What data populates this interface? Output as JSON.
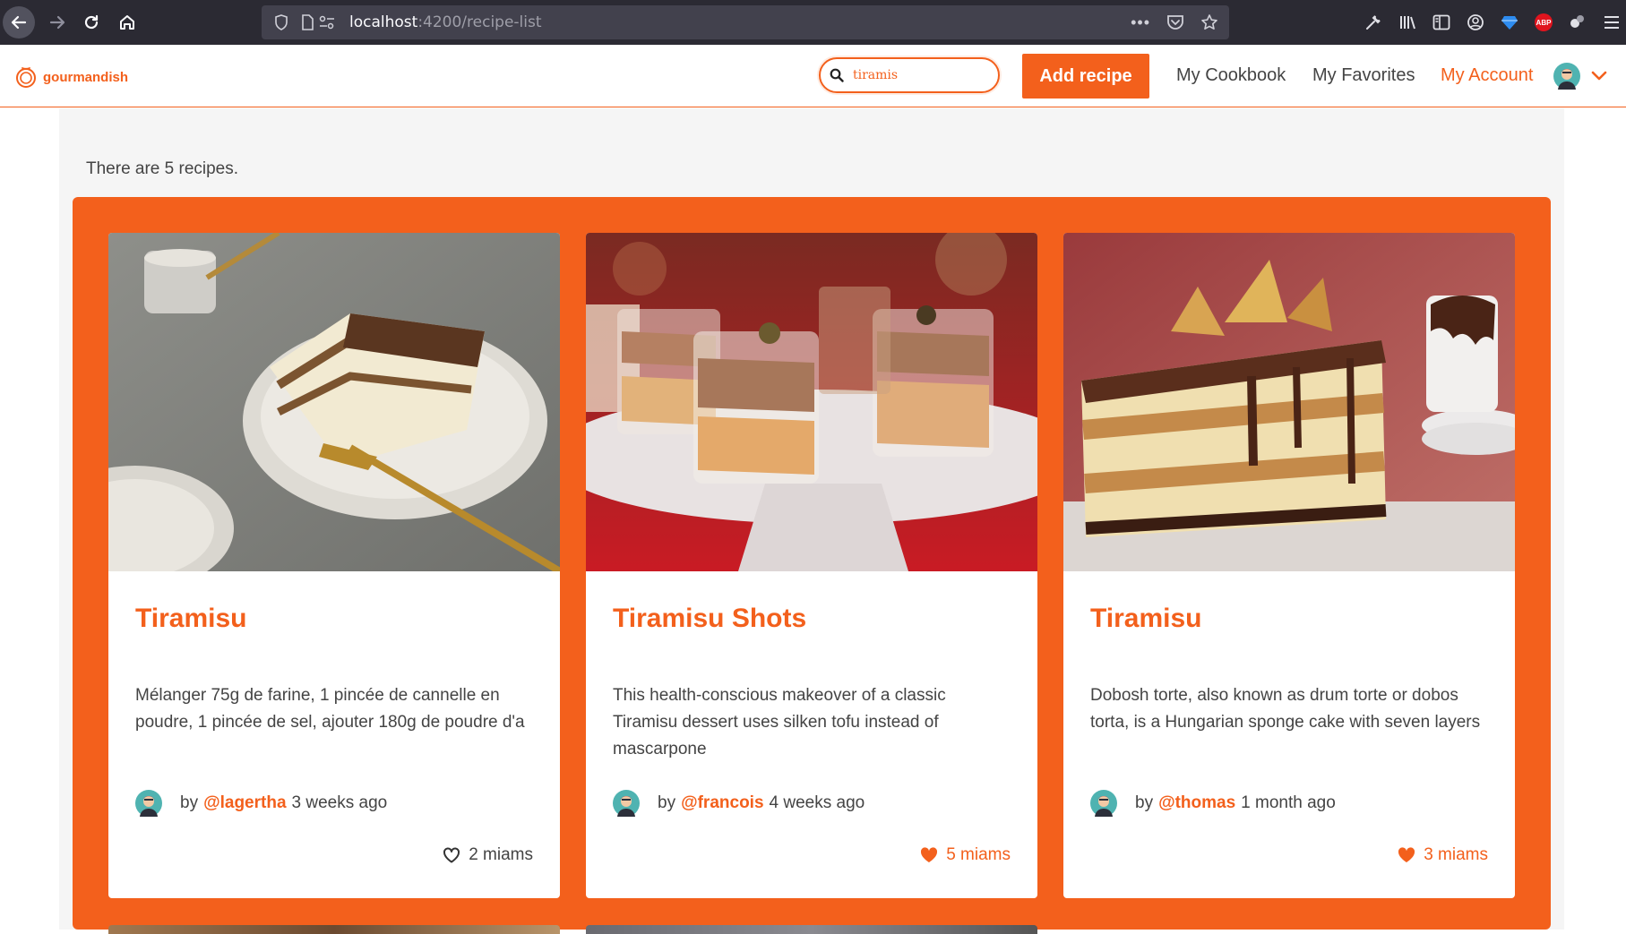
{
  "browser": {
    "url_host": "localhost",
    "url_path": ":4200/recipe-list"
  },
  "header": {
    "logo_text": "gourmandish",
    "search_value": "tiramis",
    "add_recipe_label": "Add recipe",
    "nav": {
      "cookbook": "My Cookbook",
      "favorites": "My Favorites",
      "account": "My Account"
    }
  },
  "main": {
    "recipe_count_text": "There are 5 recipes."
  },
  "recipes": [
    {
      "title": "Tiramisu",
      "description": "Mélanger 75g de farine, 1 pincée de cannelle en poudre, 1 pincée de sel, ajouter 180g de poudre d'a",
      "by": "by",
      "author": "@lagertha",
      "time": "3 weeks ago",
      "likes": "2 miams",
      "liked": false
    },
    {
      "title": "Tiramisu Shots",
      "description": "This health-conscious makeover of a classic Tiramisu dessert uses silken tofu instead of mascarpone",
      "by": "by",
      "author": "@francois",
      "time": "4 weeks ago",
      "likes": "5 miams",
      "liked": true
    },
    {
      "title": "Tiramisu",
      "description": "Dobosh torte, also known as drum torte or dobos torta, is a Hungarian sponge cake with seven layers",
      "by": "by",
      "author": "@thomas",
      "time": "1 month ago",
      "likes": "3 miams",
      "liked": true
    }
  ],
  "colors": {
    "brand": "#f3601c",
    "browser_chrome": "#2b2a33",
    "page_bg": "#f5f5f5"
  },
  "icons": [
    "back-icon",
    "forward-icon",
    "reload-icon",
    "home-icon",
    "shield-icon",
    "page-icon",
    "permissions-icon",
    "more-icon",
    "pocket-icon",
    "bookmark-star-icon",
    "wrench-icon",
    "library-icon",
    "sidebar-icon",
    "account-circle-icon",
    "diamond-extension-icon",
    "adblock-icon",
    "puzzle-icon",
    "menu-icon",
    "logo-icon",
    "search-icon",
    "avatar",
    "chevron-down-icon",
    "heart-outline-icon",
    "heart-filled-icon"
  ]
}
